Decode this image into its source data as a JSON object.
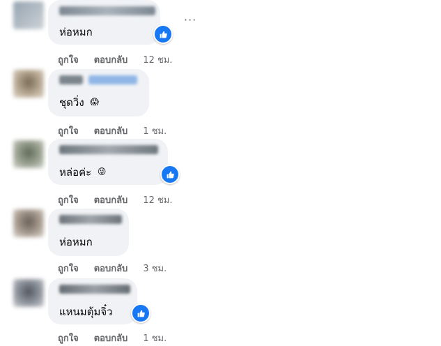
{
  "comments": [
    {
      "text": "ห่อหมก",
      "like": "ถูกใจ",
      "reply": "ตอบกลับ",
      "time": "12 ชม."
    },
    {
      "text": "ชุดวิ่ง",
      "emoji": "😱",
      "like": "ถูกใจ",
      "reply": "ตอบกลับ",
      "time": "1 ชม."
    },
    {
      "text": "หล่อค่ะ",
      "emoji": "😜",
      "like": "ถูกใจ",
      "reply": "ตอบกลับ",
      "time": "12 ชม."
    },
    {
      "text": "ห่อหมก",
      "like": "ถูกใจ",
      "reply": "ตอบกลับ",
      "time": "3 ชม."
    },
    {
      "text": "แหนมตุ้มจิ๋ว",
      "like": "ถูกใจ",
      "reply": "ตอบกลับ",
      "time": "1 ชม."
    }
  ],
  "more_icon": "···",
  "icons": {
    "like_badge": "thumbs-up-icon",
    "more": "more-dots-icon"
  },
  "colors": {
    "like_badge": "#1877f2",
    "bubble": "#f0f2f5",
    "meta": "#65676b"
  }
}
